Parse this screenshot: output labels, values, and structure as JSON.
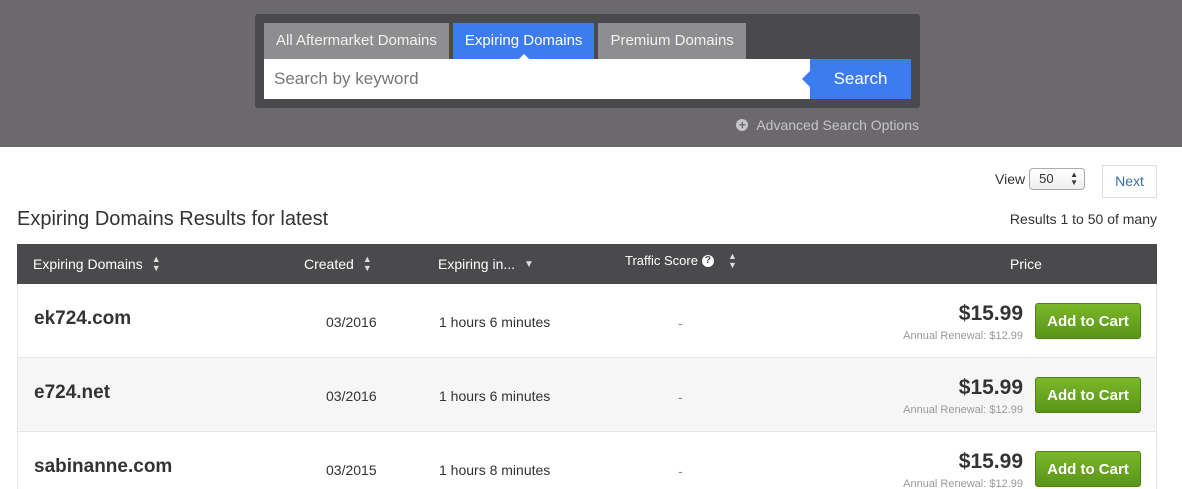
{
  "search": {
    "tabs": [
      {
        "label": "All Aftermarket Domains"
      },
      {
        "label": "Expiring Domains"
      },
      {
        "label": "Premium Domains"
      }
    ],
    "placeholder": "Search by keyword",
    "button_label": "Search",
    "advanced_label": "Advanced Search Options"
  },
  "controls": {
    "view_label": "View",
    "view_value": "50",
    "next_label": "Next"
  },
  "results": {
    "title": "Expiring Domains Results for latest",
    "count": "Results 1 to 50 of many"
  },
  "table": {
    "columns": [
      {
        "label": "Expiring Domains"
      },
      {
        "label": "Created"
      },
      {
        "label": "Expiring in..."
      },
      {
        "label": "Traffic Score"
      },
      {
        "label": "Price"
      }
    ],
    "rows": [
      {
        "domain": "ek724.com",
        "created": "03/2016",
        "expiring": "1 hours 6 minutes",
        "traffic": "-",
        "price": "$15.99",
        "renewal": "Annual Renewal: $12.99",
        "button": "Add to Cart"
      },
      {
        "domain": "e724.net",
        "created": "03/2016",
        "expiring": "1 hours 6 minutes",
        "traffic": "-",
        "price": "$15.99",
        "renewal": "Annual Renewal: $12.99",
        "button": "Add to Cart"
      },
      {
        "domain": "sabinanne.com",
        "created": "03/2015",
        "expiring": "1 hours 8 minutes",
        "traffic": "-",
        "price": "$15.99",
        "renewal": "Annual Renewal: $12.99",
        "button": "Add to Cart"
      }
    ]
  },
  "colors": {
    "banner": "#6b696b",
    "panel": "#4a494b",
    "accent": "#3d7cf0",
    "cart_green": "#6aa621"
  }
}
